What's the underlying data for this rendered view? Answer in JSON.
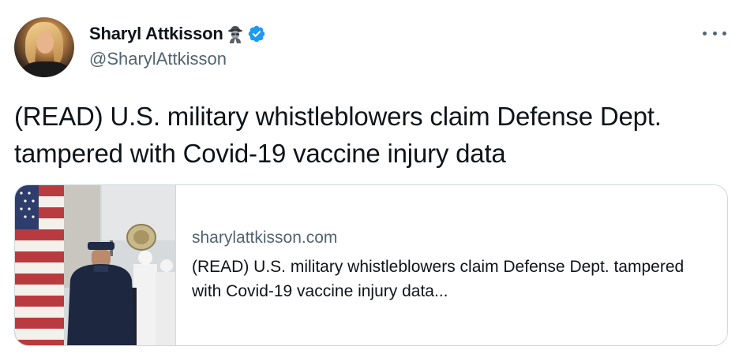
{
  "author": {
    "display_name": "Sharyl Attkisson",
    "handle": "@SharylAttkisson",
    "emoji_badge_icon": "detective-emoji",
    "verified": true,
    "verified_color": "#1d9bf0"
  },
  "tweet": {
    "text": "(READ) U.S. military whistleblowers claim Defense Dept. tampered with Covid-19 vaccine injury data"
  },
  "card": {
    "domain": "sharylattkisson.com",
    "title": "(READ) U.S. military whistleblowers claim Defense Dept. tampered with Covid-19 vaccine injury data...",
    "image_description_icon": "flag-military-band-photo"
  },
  "colors": {
    "text_primary": "#0f1419",
    "text_secondary": "#536471",
    "border": "#cfd9de",
    "brand_blue": "#1d9bf0"
  }
}
